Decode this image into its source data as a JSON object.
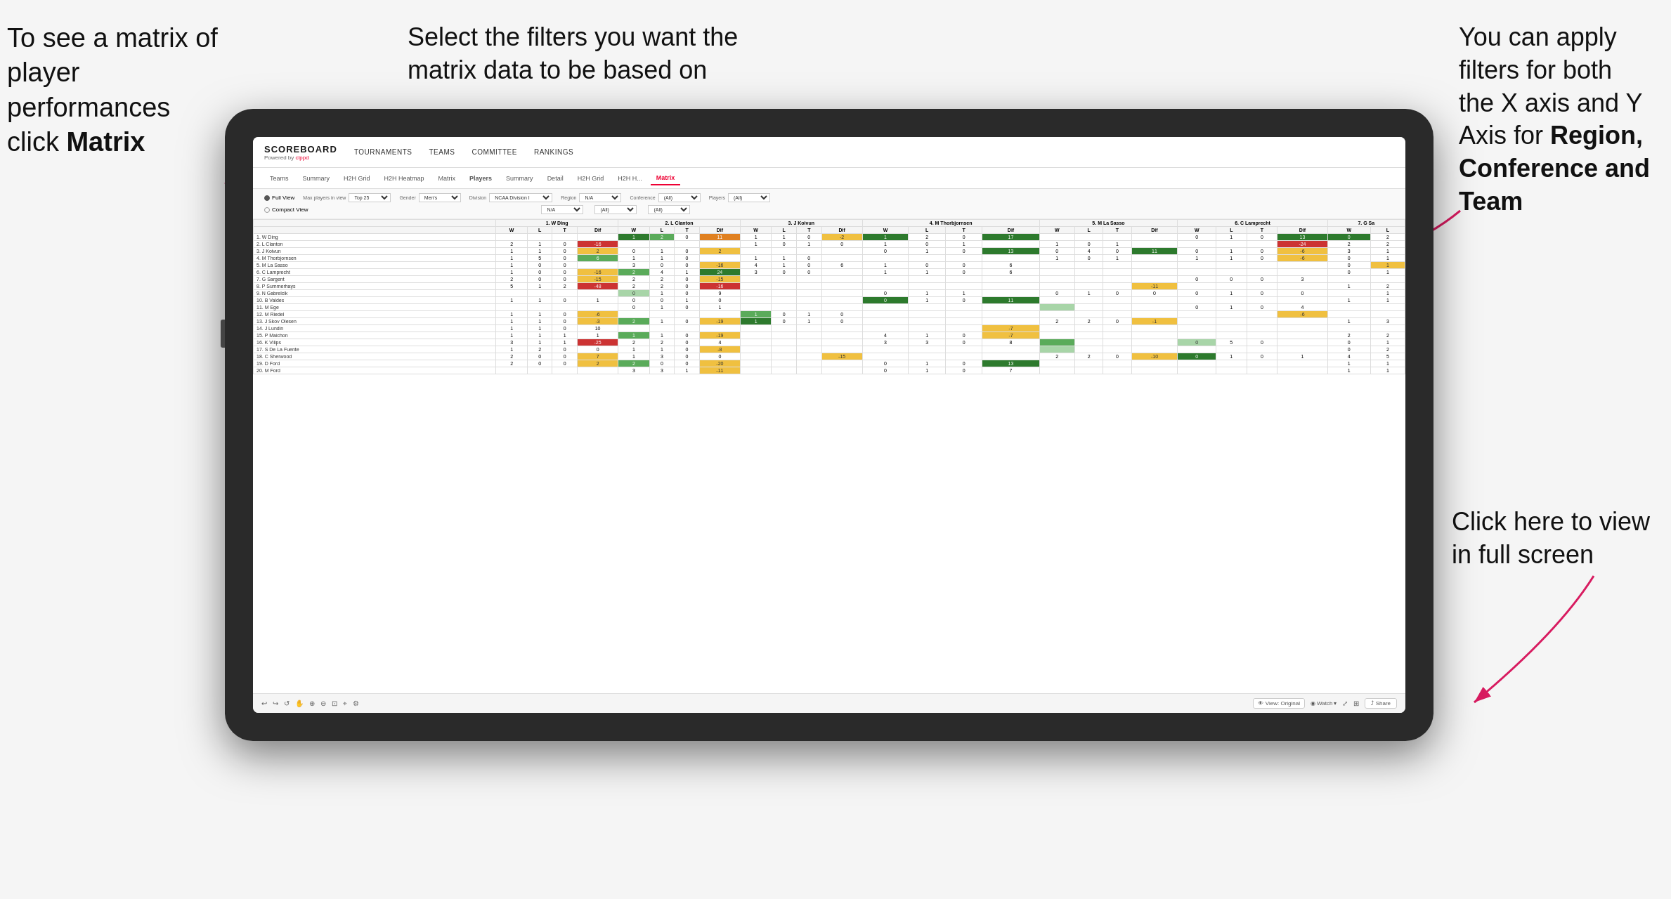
{
  "annotations": {
    "topleft_line1": "To see a matrix of",
    "topleft_line2": "player performances",
    "topleft_line3_prefix": "click ",
    "topleft_line3_bold": "Matrix",
    "topcenter": "Select the filters you want the matrix data to be based on",
    "topright_line1": "You  can apply",
    "topright_line2": "filters for both",
    "topright_line3": "the X axis and Y",
    "topright_line4_prefix": "Axis for ",
    "topright_line4_bold": "Region,",
    "topright_line5_bold": "Conference and",
    "topright_line6_bold": "Team",
    "bottomright_line1": "Click here to view",
    "bottomright_line2": "in full screen"
  },
  "app": {
    "logo_text": "SCOREBOARD",
    "logo_powered": "Powered by clppd",
    "nav_items": [
      "TOURNAMENTS",
      "TEAMS",
      "COMMITTEE",
      "RANKINGS"
    ],
    "sub_nav_items": [
      "Teams",
      "Summary",
      "H2H Grid",
      "H2H Heatmap",
      "Matrix",
      "Players",
      "Summary",
      "Detail",
      "H2H Grid",
      "H2H H...",
      "Matrix"
    ],
    "active_tab": "Matrix"
  },
  "filters": {
    "view_options": [
      "Full View",
      "Compact View"
    ],
    "selected_view": "Full View",
    "max_players_label": "Max players in view",
    "max_players_value": "Top 25",
    "gender_label": "Gender",
    "gender_value": "Men's",
    "division_label": "Division",
    "division_value": "NCAA Division I",
    "region_label": "Region",
    "region_value": "N/A",
    "region_value2": "N/A",
    "conference_label": "Conference",
    "conference_value": "(All)",
    "conference_value2": "(All)",
    "players_label": "Players",
    "players_value": "(All)",
    "players_value2": "(All)"
  },
  "matrix": {
    "column_headers": [
      "1. W Ding",
      "2. L Clanton",
      "3. J Koivun",
      "4. M Thorbjornsen",
      "5. M La Sasso",
      "6. C Lamprecht",
      "7. G Sa"
    ],
    "sub_headers": [
      "W",
      "L",
      "T",
      "Dif"
    ],
    "rows": [
      {
        "name": "1. W Ding",
        "cells": [
          {
            "color": "white"
          },
          {
            "color": "green-dark",
            "val": "1"
          },
          {
            "color": "green-med",
            "val": "2"
          },
          {
            "color": "white",
            "val": "0"
          },
          {
            "color": "orange",
            "val": "11"
          },
          {
            "color": "white",
            "val": "1"
          },
          {
            "color": "white",
            "val": "1"
          },
          {
            "color": "white",
            "val": "0"
          },
          {
            "color": "yellow",
            "val": "-2"
          },
          {
            "color": "green-dark",
            "val": "1"
          },
          {
            "color": "white",
            "val": "2"
          },
          {
            "color": "white",
            "val": "0"
          },
          {
            "color": "green-dark",
            "val": "17"
          }
        ]
      },
      {
        "name": "2. L Clanton",
        "cells": [
          {
            "color": "white",
            "val": "2"
          },
          {
            "color": "white",
            "val": "1"
          },
          {
            "color": "white",
            "val": "0"
          },
          {
            "color": "red",
            "val": "-16"
          },
          {
            "color": "white"
          },
          {
            "color": "white",
            "val": "1"
          },
          {
            "color": "white",
            "val": "0"
          },
          {
            "color": "white",
            "val": "1"
          },
          {
            "color": "white",
            "val": "0"
          },
          {
            "color": "white",
            "val": "1"
          },
          {
            "color": "white",
            "val": "1"
          },
          {
            "color": "white",
            "val": "0"
          },
          {
            "color": "red",
            "val": "-24"
          },
          {
            "color": "white",
            "val": "2"
          },
          {
            "color": "white",
            "val": "2"
          }
        ]
      },
      {
        "name": "3. J Koivun",
        "cells": [
          {
            "color": "white",
            "val": "1"
          },
          {
            "color": "white",
            "val": "1"
          },
          {
            "color": "white",
            "val": "0"
          },
          {
            "color": "yellow",
            "val": "2"
          },
          {
            "color": "white",
            "val": "0"
          },
          {
            "color": "white",
            "val": "1"
          },
          {
            "color": "white",
            "val": "0"
          },
          {
            "color": "yellow",
            "val": "2"
          },
          {
            "color": "white"
          },
          {
            "color": "white",
            "val": "0"
          },
          {
            "color": "white",
            "val": "1"
          },
          {
            "color": "white",
            "val": "0"
          },
          {
            "color": "green-dark",
            "val": "13"
          },
          {
            "color": "white",
            "val": "0"
          },
          {
            "color": "white",
            "val": "1"
          },
          {
            "color": "white",
            "val": "0"
          },
          {
            "color": "white",
            "val": "3"
          },
          {
            "color": "white",
            "val": "1"
          },
          {
            "color": "white",
            "val": "2"
          }
        ]
      },
      {
        "name": "4. M Thorbjornsen",
        "cells": []
      },
      {
        "name": "5. M La Sasso",
        "cells": []
      },
      {
        "name": "6. C Lamprecht",
        "cells": []
      },
      {
        "name": "7. G Sargent",
        "cells": []
      },
      {
        "name": "8. P Summerhays",
        "cells": []
      },
      {
        "name": "9. N Gabrelcik",
        "cells": []
      },
      {
        "name": "10. B Valdes",
        "cells": []
      },
      {
        "name": "11. M Ege",
        "cells": []
      },
      {
        "name": "12. M Riedel",
        "cells": []
      },
      {
        "name": "13. J Skov Olesen",
        "cells": []
      },
      {
        "name": "14. J Lundin",
        "cells": []
      },
      {
        "name": "15. P Maichon",
        "cells": []
      },
      {
        "name": "16. K Vilips",
        "cells": []
      },
      {
        "name": "17. S De La Fuente",
        "cells": []
      },
      {
        "name": "18. C Sherwood",
        "cells": []
      },
      {
        "name": "19. D Ford",
        "cells": []
      },
      {
        "name": "20. M Ford",
        "cells": []
      }
    ]
  },
  "toolbar": {
    "view_original": "View: Original",
    "watch": "Watch",
    "share": "Share"
  }
}
